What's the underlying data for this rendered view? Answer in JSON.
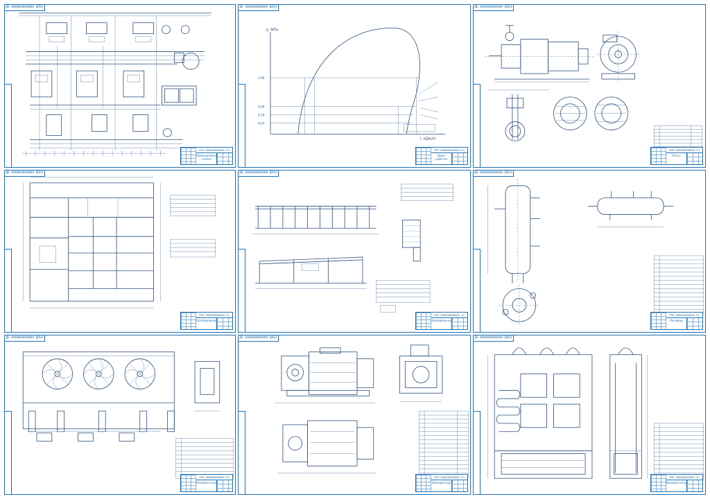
{
  "sheets": [
    {
      "id": "s1",
      "code": "ДБ 000000000000 ДП03",
      "stamp_code": "МЧР 000000000000 ЧЧ",
      "title": "Принципиальная схема"
    },
    {
      "id": "s2",
      "code": "ДБ 000000000000 ДП03",
      "stamp_code": "МЧР 000000000000 ЧЧ",
      "title": "Цикл работы"
    },
    {
      "id": "s3",
      "code": "ДБ 000000000000 ДП03",
      "stamp_code": "МЧР 000000000000 ЧЧ",
      "title": "Насос"
    },
    {
      "id": "s4",
      "code": "ДБ 000000000000 ДП03",
      "stamp_code": "МЧР 000000000000 ЧЧ",
      "title": "Холодильник"
    },
    {
      "id": "s5",
      "code": "ДБ 000000000000 ДП03",
      "stamp_code": "МЧР 000000000000 ЧЧ",
      "title": "Холодильник"
    },
    {
      "id": "s6",
      "code": "ДБ 000000000000 ДП03",
      "stamp_code": "МЧР 000000000000 ЧЧ",
      "title": "Ресивер"
    },
    {
      "id": "s7",
      "code": "ДБ 000000000000 ДП03",
      "stamp_code": "МЧР 000000000000 ЧЧ",
      "title": "Конденсатор"
    },
    {
      "id": "s8",
      "code": "ДБ 000000000000 ДП03",
      "stamp_code": "МЧР 000000000000 ЧЧ",
      "title": "Компрессор"
    },
    {
      "id": "s9",
      "code": "ДБ 000000000000 ДП03",
      "stamp_code": "МЧР 000000000000 ЧЧ",
      "title": "Конденсатор"
    }
  ],
  "cycle_diagram": {
    "y_axis_label": "p, МПа",
    "x_axis_label": "i, кДж/кг",
    "pressure_ticks": [
      "1,60",
      "0,29",
      "0,19",
      "0,07"
    ]
  }
}
